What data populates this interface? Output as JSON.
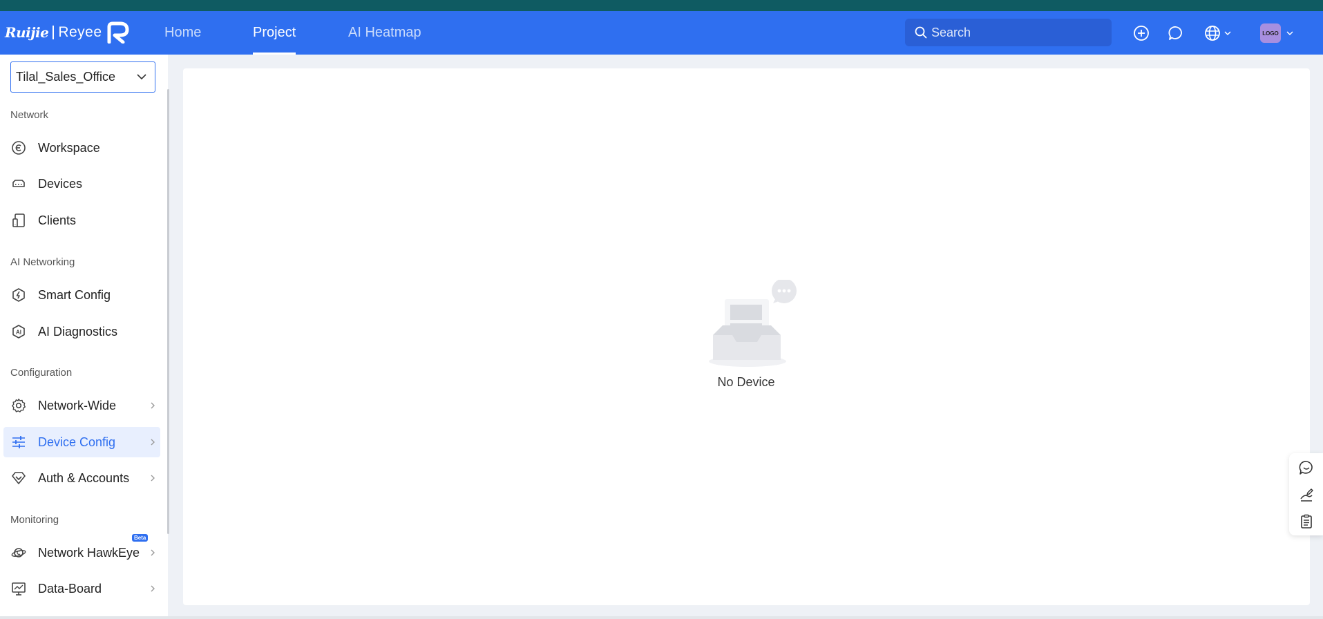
{
  "brand": {
    "name": "Ruijie",
    "product": "Reyee"
  },
  "nav": {
    "tabs": [
      {
        "label": "Home"
      },
      {
        "label": "Project",
        "active": true
      },
      {
        "label": "AI Heatmap"
      }
    ],
    "search": {
      "placeholder": "Search"
    },
    "icons": [
      "add-icon",
      "message-icon",
      "globe-icon",
      "avatar"
    ],
    "avatar_text": "LOGO"
  },
  "sidebar": {
    "project": {
      "selected": "Tilal_Sales_Office"
    },
    "sections": [
      {
        "label": "Network"
      },
      {
        "label": "AI Networking"
      },
      {
        "label": "Configuration"
      },
      {
        "label": "Monitoring"
      }
    ],
    "items": [
      {
        "label": "Workspace",
        "icon": "workspace-icon"
      },
      {
        "label": "Devices",
        "icon": "devices-icon"
      },
      {
        "label": "Clients",
        "icon": "clients-icon"
      },
      {
        "label": "Smart Config",
        "icon": "smart-config-icon"
      },
      {
        "label": "AI Diagnostics",
        "icon": "ai-diagnostics-icon"
      },
      {
        "label": "Network-Wide",
        "icon": "gear-icon"
      },
      {
        "label": "Device Config",
        "icon": "sliders-icon",
        "active": true
      },
      {
        "label": "Auth & Accounts",
        "icon": "diamond-icon"
      },
      {
        "label": "Network HawkEye",
        "icon": "planet-icon",
        "badge": "Beta"
      },
      {
        "label": "Data-Board",
        "icon": "monitor-chart-icon"
      }
    ]
  },
  "main": {
    "empty_text": "No Device"
  },
  "float_tools": [
    "chat-icon",
    "feedback-icon",
    "clipboard-icon"
  ],
  "colors": {
    "primary": "#2f6ff0",
    "top_strip": "#0f5b62",
    "active_bg": "#e8effe"
  }
}
